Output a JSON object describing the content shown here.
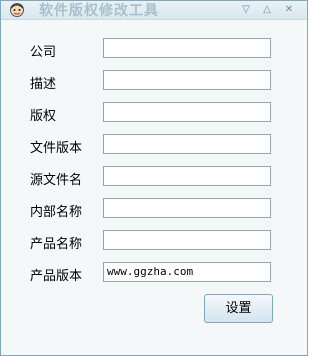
{
  "window": {
    "title": "软件版权修改工具"
  },
  "fields": [
    {
      "label": "公司",
      "value": ""
    },
    {
      "label": "描述",
      "value": ""
    },
    {
      "label": "版权",
      "value": ""
    },
    {
      "label": "文件版本",
      "value": ""
    },
    {
      "label": "源文件名",
      "value": ""
    },
    {
      "label": "内部名称",
      "value": ""
    },
    {
      "label": "产品名称",
      "value": ""
    },
    {
      "label": "产品版本",
      "value": "www.ggzha.com"
    }
  ],
  "buttons": {
    "settings": "设置"
  }
}
